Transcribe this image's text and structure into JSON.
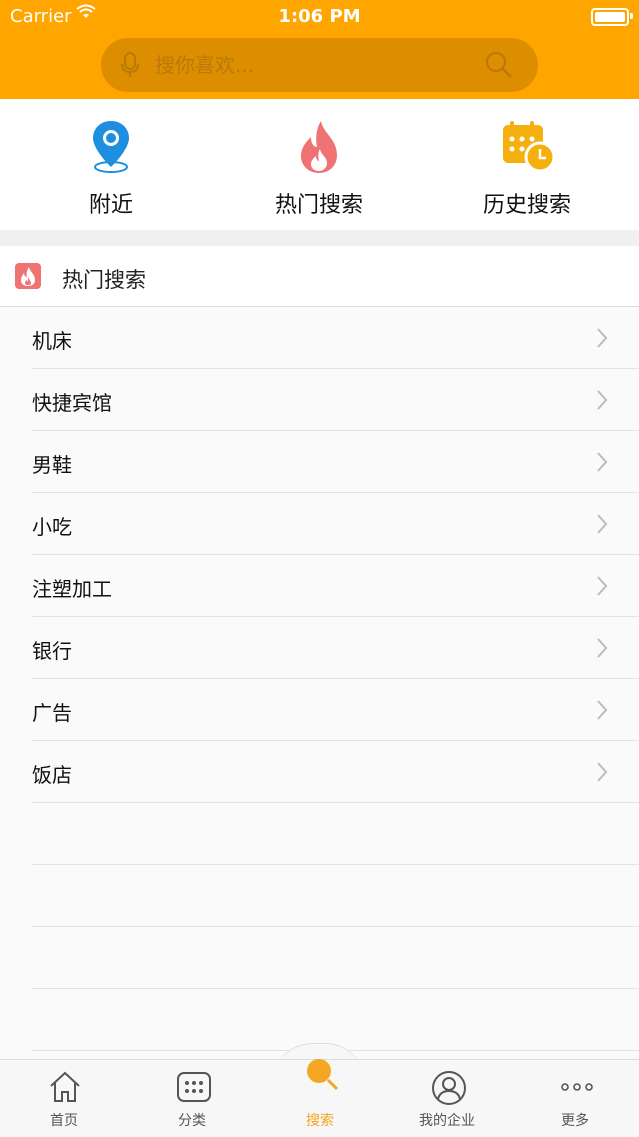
{
  "status": {
    "carrier": "Carrier",
    "time": "1:06 PM"
  },
  "search": {
    "placeholder": "搜你喜欢..."
  },
  "quick_links": [
    {
      "label": "附近",
      "icon": "location-pin-icon"
    },
    {
      "label": "热门搜索",
      "icon": "flame-icon"
    },
    {
      "label": "历史搜索",
      "icon": "calendar-clock-icon"
    }
  ],
  "hot_section": {
    "title": "热门搜索",
    "icon": "flame-badge-icon"
  },
  "hot_items": [
    "机床",
    "快捷宾馆",
    "男鞋",
    "小吃",
    "注塑加工",
    "银行",
    "广告",
    "饭店"
  ],
  "tabs": [
    {
      "label": "首页",
      "icon": "home-icon"
    },
    {
      "label": "分类",
      "icon": "grid-icon"
    },
    {
      "label": "搜索",
      "icon": "search-icon",
      "active": true
    },
    {
      "label": "我的企业",
      "icon": "person-icon"
    },
    {
      "label": "更多",
      "icon": "more-icon"
    }
  ],
  "colors": {
    "accent": "#ffa500",
    "search_bg": "#dd8e00",
    "flame": "#ef7373",
    "pin": "#1e8fe0",
    "active_tab": "#f5a623"
  }
}
